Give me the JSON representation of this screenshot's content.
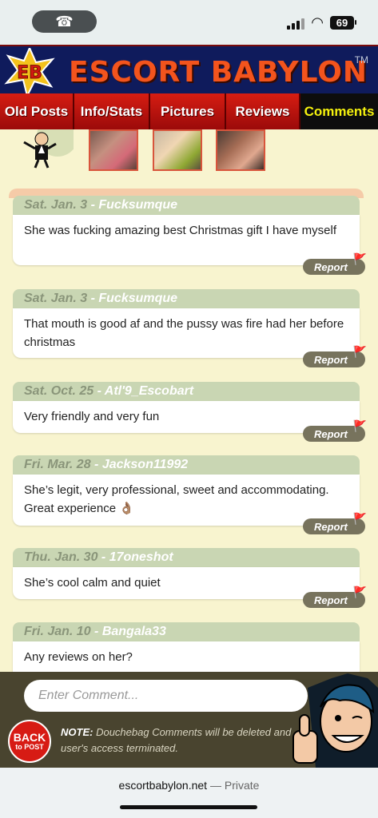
{
  "status_bar": {
    "call_icon": "phone-icon",
    "battery": "69"
  },
  "header": {
    "badge": "EB",
    "brand": "ESCORT BABYLON",
    "tm": "TM"
  },
  "nav": {
    "tabs": [
      {
        "label": "Old Posts"
      },
      {
        "label": "Info/Stats"
      },
      {
        "label": "Pictures"
      },
      {
        "label": "Reviews"
      },
      {
        "label": "Comments"
      }
    ],
    "active_color": "#f5f20e"
  },
  "comments": [
    {
      "date": "Sat. Jan. 3",
      "user": "Fucksumque",
      "text": "She was fucking amazing best Christmas gift I have myself",
      "report": "Report"
    },
    {
      "date": "Sat. Jan. 3",
      "user": "Fucksumque",
      "text": "That mouth is good af and the pussy was fire had her before christmas",
      "report": "Report"
    },
    {
      "date": "Sat. Oct. 25",
      "user": "Atl'9_Escobart",
      "text": "Very friendly and very fun",
      "report": "Report"
    },
    {
      "date": "Fri. Mar. 28",
      "user": "Jackson11992",
      "text": "She’s legit, very professional, sweet and accommodating. Great experience 👌🏽",
      "report": "Report"
    },
    {
      "date": "Thu. Jan. 30",
      "user": "17oneshot",
      "text": "She’s cool calm and quiet",
      "report": "Report"
    },
    {
      "date": "Fri. Jan. 10",
      "user": "Bangala33",
      "text": "Any reviews on her?",
      "report": "Report"
    }
  ],
  "comment_bar": {
    "placeholder": "Enter Comment...",
    "back_line1": "BACK",
    "back_line2": "to POST",
    "note_label": "NOTE:",
    "note_text": "Douchebag Comments will be deleted and user's access terminated."
  },
  "url_bar": {
    "domain": "escortbabylon.net",
    "separator": " — ",
    "privacy": "Private"
  }
}
